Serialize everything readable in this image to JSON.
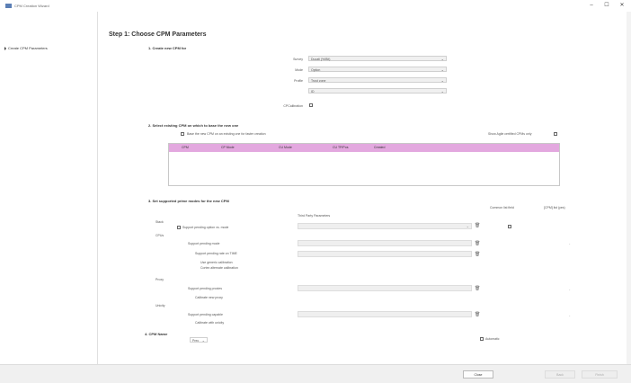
{
  "window": {
    "title": "CPM Creation Wizard",
    "min": "–",
    "max": "☐",
    "close": "✕"
  },
  "sidebar": {
    "items": [
      {
        "label": "Create CPM Parameters"
      }
    ]
  },
  "step": {
    "title": "Step 1: Choose CPM Parameters"
  },
  "section1": {
    "title": "1. Create new CPM for",
    "fields": [
      {
        "label": "Survey",
        "value": "Ducati (%/Bit)"
      },
      {
        "label": "Mode",
        "value": "Option"
      },
      {
        "label": "Profile",
        "value": "Trust zone"
      },
      {
        "label": "",
        "value": "ID"
      }
    ],
    "calibration_label": "CPCalibration"
  },
  "section2": {
    "title": "2. Select existing CPM on which to base the new one",
    "base_checkbox_label": "Base the new CPM on an existing one for faster creation",
    "show_agile_label": "Show Agile certified CPMs only",
    "columns": [
      "CPM",
      "CP Mode",
      "CU Mode",
      "CU TP/Pos",
      "Created"
    ]
  },
  "section3": {
    "title": "3. Set supported prime modes for the new CPM",
    "col_third_party": "Third Party Parameters",
    "col_common": "Common list field",
    "col_cpm": "[CPM] list (yes)",
    "groups": [
      {
        "name": "Stack",
        "rows": [
          {
            "label": "Support pending option vs. mode"
          }
        ]
      },
      {
        "name": "CPUs",
        "rows": [
          {
            "label": "Support pending mode"
          },
          {
            "label": "Support pending rate on TIME"
          },
          {
            "label": "Use generic calibration"
          },
          {
            "label": "Cortex alternate calibration"
          }
        ]
      },
      {
        "name": "Proxy",
        "rows": [
          {
            "label": "Support pending proxies"
          },
          {
            "label": "Calibrate new proxy"
          }
        ]
      },
      {
        "name": "Unicity",
        "rows": [
          {
            "label": "Support pending capable"
          },
          {
            "label": "Calibrate with unicity"
          }
        ]
      }
    ]
  },
  "section4": {
    "title": "4. CPM Name",
    "prefix_value": "Prec",
    "automatic_label": "Automatic"
  },
  "footer": {
    "close_label": "Close",
    "back_label": "Back",
    "finish_label": "Finish"
  }
}
